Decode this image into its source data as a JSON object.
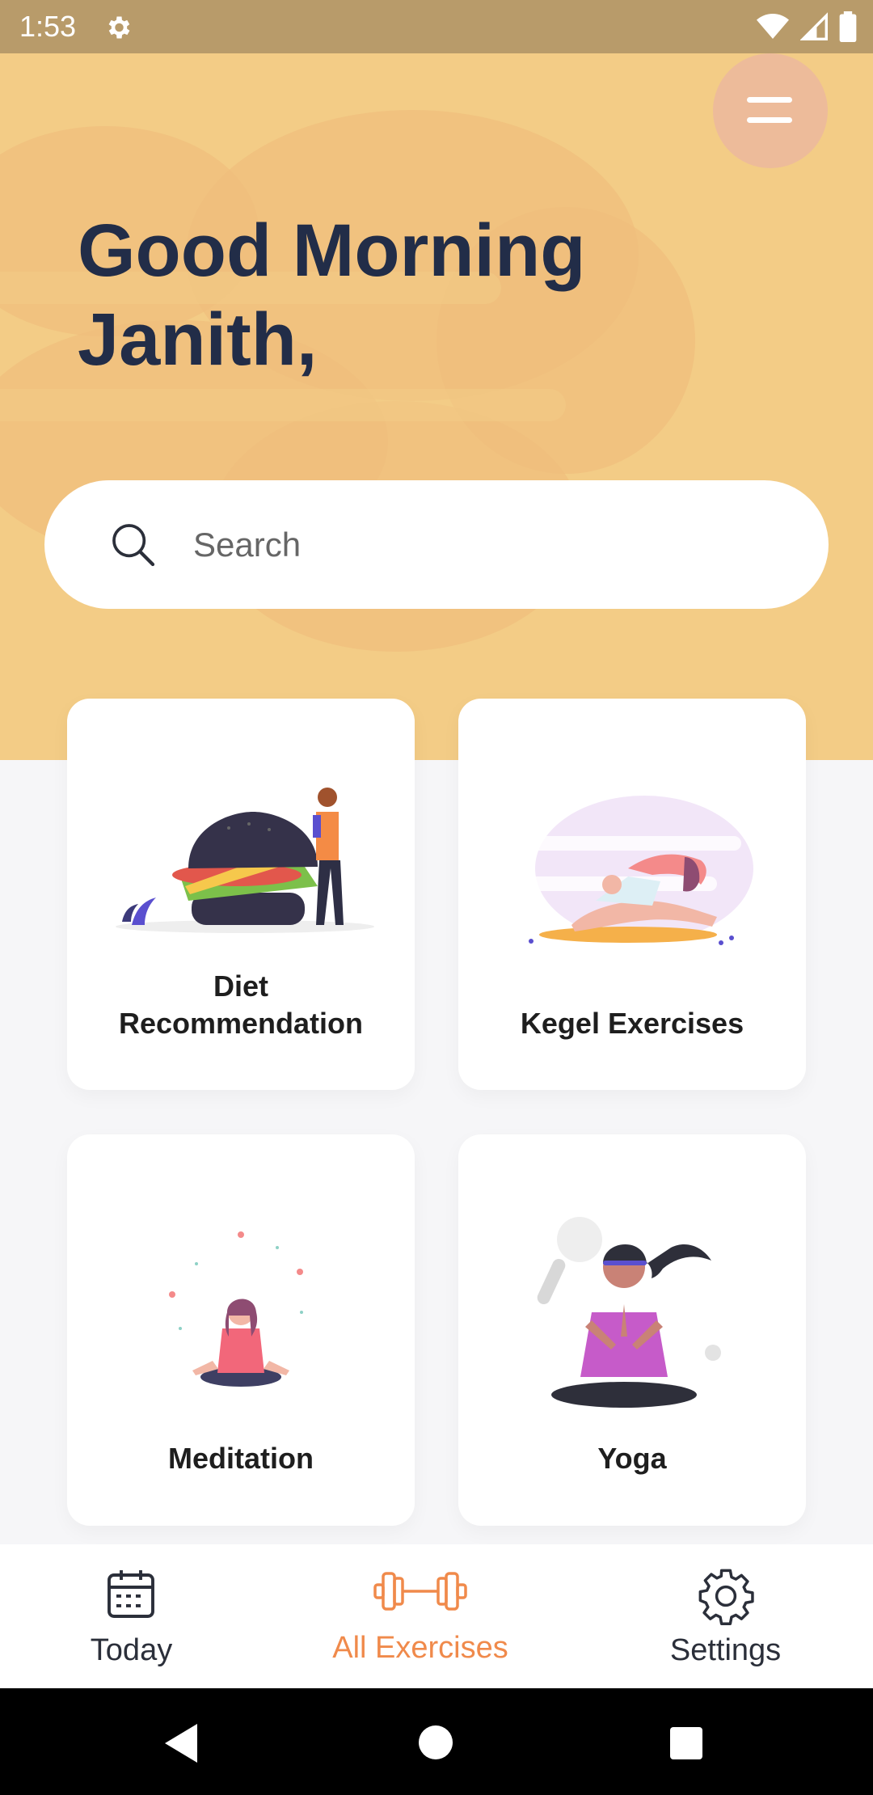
{
  "status_bar": {
    "time": "1:53",
    "icons": [
      "gear-icon",
      "wifi-icon",
      "signal-icon",
      "battery-icon"
    ]
  },
  "header": {
    "greeting": "Good Morning\nJanith,",
    "menu_icon": "menu-icon"
  },
  "search": {
    "placeholder": "Search",
    "icon": "search-icon"
  },
  "cards": [
    {
      "label": "Diet\nRecommendation",
      "icon": "diet-illustration"
    },
    {
      "label": "Kegel Exercises",
      "icon": "kegel-illustration"
    },
    {
      "label": "Meditation",
      "icon": "meditation-illustration"
    },
    {
      "label": "Yoga",
      "icon": "yoga-illustration"
    }
  ],
  "bottom_nav": {
    "items": [
      {
        "label": "Today",
        "icon": "calendar-icon",
        "active": false
      },
      {
        "label": "All Exercises",
        "icon": "dumbbell-icon",
        "active": true
      },
      {
        "label": "Settings",
        "icon": "gear-icon",
        "active": false
      }
    ]
  },
  "colors": {
    "header_bg": "#F3CC86",
    "accent": "#F08A4B",
    "text_dark": "#222D48",
    "statusbar": "#B89B6A"
  }
}
